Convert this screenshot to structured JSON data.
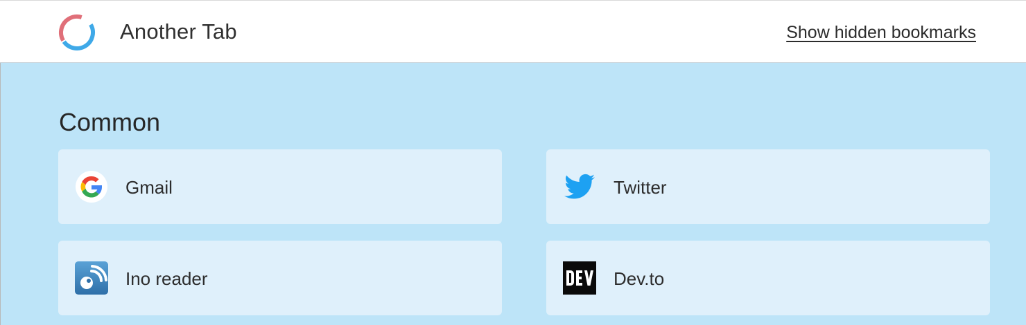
{
  "app": {
    "title": "Another Tab",
    "logo_icon": "another-tab-logo"
  },
  "header": {
    "hidden_bookmarks_link": "Show hidden bookmarks"
  },
  "section": {
    "title": "Common"
  },
  "bookmarks": [
    {
      "label": "Gmail",
      "icon": "google-icon"
    },
    {
      "label": "Twitter",
      "icon": "twitter-icon"
    },
    {
      "label": "Ino reader",
      "icon": "inoreader-icon"
    },
    {
      "label": "Dev.to",
      "icon": "devto-icon"
    }
  ],
  "colors": {
    "background": "#bde4f8",
    "card": "#dff0fb",
    "header": "#ffffff",
    "twitter_blue": "#1da1f2",
    "logo_blue": "#3fa9e8",
    "logo_red": "#e06f79"
  }
}
